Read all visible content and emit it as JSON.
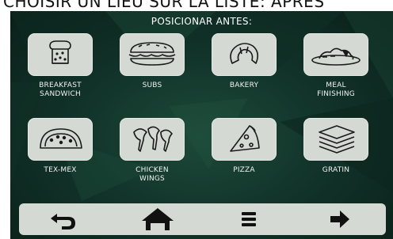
{
  "caption": "CHOISIR UN LIEU SUR LA LISTE: APRÈS",
  "screen": {
    "title": "POSICIONAR ANTES:",
    "categories": [
      {
        "label_line1": "BREAKFAST",
        "label_line2": "SANDWICH",
        "icon": "sandwich-icon"
      },
      {
        "label_line1": "SUBS",
        "label_line2": "",
        "icon": "sub-sandwich-icon"
      },
      {
        "label_line1": "BAKERY",
        "label_line2": "",
        "icon": "croissant-icon"
      },
      {
        "label_line1": "MEAL",
        "label_line2": "FINISHING",
        "icon": "plated-meal-icon"
      },
      {
        "label_line1": "TEX-MEX",
        "label_line2": "",
        "icon": "taco-icon"
      },
      {
        "label_line1": "CHICKEN",
        "label_line2": "WINGS",
        "icon": "chicken-wings-icon"
      },
      {
        "label_line1": "PIZZA",
        "label_line2": "",
        "icon": "pizza-slice-icon"
      },
      {
        "label_line1": "GRATIN",
        "label_line2": "",
        "icon": "gratin-layers-icon"
      }
    ]
  },
  "nav": {
    "items": [
      {
        "icon": "back-arrow-icon"
      },
      {
        "icon": "home-icon"
      },
      {
        "icon": "menu-icon"
      },
      {
        "icon": "forward-arrow-icon"
      }
    ]
  },
  "colors": {
    "background": "#12342a",
    "tile": "#d4d9d4",
    "icon_stroke": "#1a1a1a",
    "text": "#ffffff"
  }
}
